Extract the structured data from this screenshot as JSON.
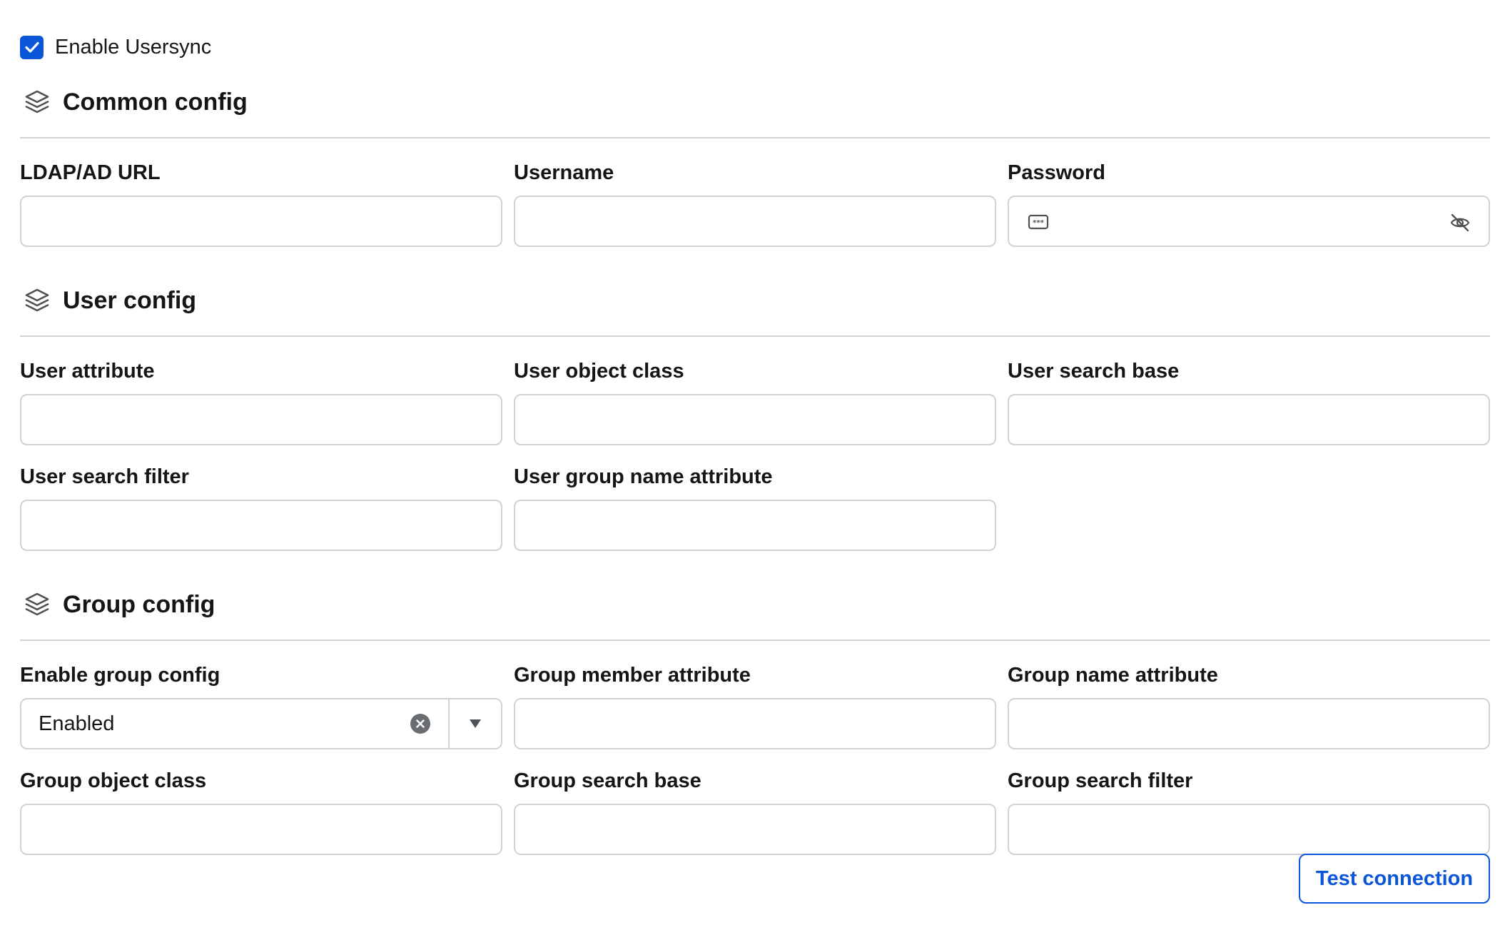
{
  "enable_usersync": {
    "label": "Enable Usersync",
    "checked": true
  },
  "sections": {
    "common": {
      "title": "Common config",
      "icon": "layers-icon"
    },
    "user": {
      "title": "User config",
      "icon": "layers-icon"
    },
    "group": {
      "title": "Group config",
      "icon": "layers-icon"
    }
  },
  "common_fields": {
    "ldap_url": {
      "label": "LDAP/AD URL",
      "value": ""
    },
    "username": {
      "label": "Username",
      "value": ""
    },
    "password": {
      "label": "Password",
      "value": "",
      "lead_icon": "password-dots-icon",
      "toggle_icon": "eye-slash-icon"
    }
  },
  "user_fields": {
    "user_attribute": {
      "label": "User attribute",
      "value": ""
    },
    "user_object_class": {
      "label": "User object class",
      "value": ""
    },
    "user_search_base": {
      "label": "User search base",
      "value": ""
    },
    "user_search_filter": {
      "label": "User search filter",
      "value": ""
    },
    "user_group_name_attribute": {
      "label": "User group name attribute",
      "value": ""
    }
  },
  "group_fields": {
    "enable_group_config": {
      "label": "Enable group config",
      "selected": "Enabled",
      "clear_icon": "clear-circle-icon",
      "toggle_icon": "caret-down-icon"
    },
    "group_member_attribute": {
      "label": "Group member attribute",
      "value": ""
    },
    "group_name_attribute": {
      "label": "Group name attribute",
      "value": ""
    },
    "group_object_class": {
      "label": "Group object class",
      "value": ""
    },
    "group_search_base": {
      "label": "Group search base",
      "value": ""
    },
    "group_search_filter": {
      "label": "Group search filter",
      "value": ""
    }
  },
  "actions": {
    "test_connection": "Test connection"
  },
  "colors": {
    "accent": "#0b55d9",
    "border": "#d2d2d2",
    "text": "#151515"
  }
}
